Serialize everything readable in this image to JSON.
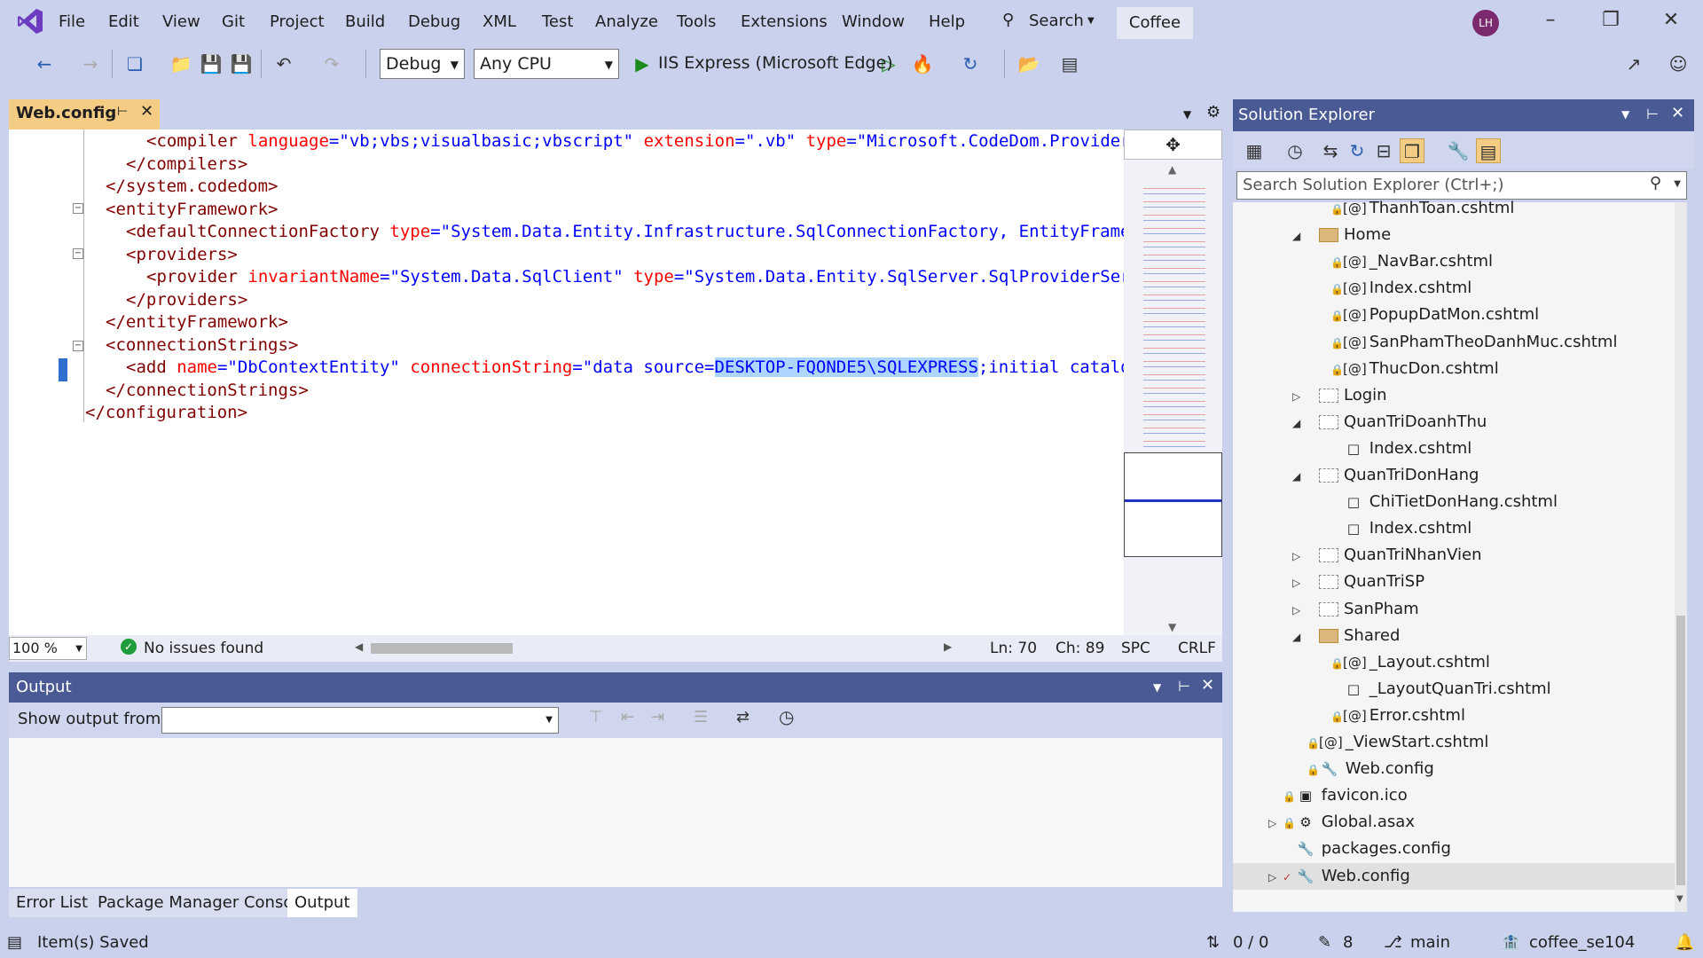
{
  "menubar": {
    "items": [
      "File",
      "Edit",
      "View",
      "Git",
      "Project",
      "Build",
      "Debug",
      "XML",
      "Test",
      "Analyze",
      "Tools",
      "Extensions",
      "Window",
      "Help"
    ],
    "search_label": "Search",
    "solution_name": "Coffee",
    "user_initials": "LH"
  },
  "toolbar": {
    "config": "Debug",
    "platform": "Any CPU",
    "run_target": "IIS Express (Microsoft Edge)"
  },
  "editor": {
    "tab_title": "Web.config",
    "zoom": "100 %",
    "issues": "No issues found",
    "line": "Ln: 70",
    "char": "Ch: 89",
    "whitespace": "SPC",
    "line_ending": "CRLF",
    "code": [
      {
        "indent": 3,
        "parts": [
          [
            "<",
            "tag"
          ],
          [
            "compiler ",
            "tag"
          ],
          [
            "language",
            "attr"
          ],
          [
            "=\"",
            "val"
          ],
          [
            "vb;vbs;visualbasic;vbscript",
            "val"
          ],
          [
            "\" ",
            "val"
          ],
          [
            "extension",
            "attr"
          ],
          [
            "=\".vb\" ",
            "val"
          ],
          [
            "type",
            "attr"
          ],
          [
            "=\"Microsoft.CodeDom.Provider",
            "val"
          ]
        ]
      },
      {
        "indent": 2,
        "parts": [
          [
            "</compilers>",
            "tag"
          ]
        ]
      },
      {
        "indent": 1,
        "parts": [
          [
            "</system.codedom>",
            "tag"
          ]
        ]
      },
      {
        "indent": 1,
        "parts": [
          [
            "<entityFramework>",
            "tag"
          ]
        ]
      },
      {
        "indent": 2,
        "parts": [
          [
            "<defaultConnectionFactory ",
            "tag"
          ],
          [
            "type",
            "attr"
          ],
          [
            "=\"System.Data.Entity.Infrastructure.SqlConnectionFactory, EntityFrame",
            "val"
          ]
        ]
      },
      {
        "indent": 2,
        "parts": [
          [
            "<providers>",
            "tag"
          ]
        ]
      },
      {
        "indent": 3,
        "parts": [
          [
            "<provider ",
            "tag"
          ],
          [
            "invariantName",
            "attr"
          ],
          [
            "=\"System.Data.SqlClient\" ",
            "val"
          ],
          [
            "type",
            "attr"
          ],
          [
            "=\"System.Data.Entity.SqlServer.SqlProviderSer",
            "val"
          ]
        ]
      },
      {
        "indent": 2,
        "parts": [
          [
            "</providers>",
            "tag"
          ]
        ]
      },
      {
        "indent": 1,
        "parts": [
          [
            "</entityFramework>",
            "tag"
          ]
        ]
      },
      {
        "indent": 1,
        "parts": [
          [
            "<connectionStrings>",
            "tag"
          ]
        ]
      },
      {
        "indent": 2,
        "parts": [
          [
            "<add ",
            "tag"
          ],
          [
            "name",
            "attr"
          ],
          [
            "=\"DbContextEntity\" ",
            "val"
          ],
          [
            "connectionString",
            "attr"
          ],
          [
            "=\"data source=",
            "val"
          ],
          [
            "DESKTOP-FQONDE5\\SQLEXPRESS",
            "sel"
          ],
          [
            ";initial catalo",
            "val"
          ]
        ]
      },
      {
        "indent": 1,
        "parts": [
          [
            "</connectionStrings>",
            "tag"
          ]
        ]
      },
      {
        "indent": 0,
        "parts": [
          [
            "</configuration>",
            "tag"
          ]
        ]
      }
    ]
  },
  "solution_explorer": {
    "title": "Solution Explorer",
    "search_placeholder": "Search Solution Explorer (Ctrl+;)",
    "items": [
      {
        "label": "ThanhToan.cshtml",
        "indent": 3,
        "type": "razor",
        "lock": true,
        "expander": ""
      },
      {
        "label": "Home",
        "indent": 2,
        "type": "folder",
        "lock": false,
        "expander": "open"
      },
      {
        "label": "_NavBar.cshtml",
        "indent": 3,
        "type": "razor",
        "lock": true,
        "expander": ""
      },
      {
        "label": "Index.cshtml",
        "indent": 3,
        "type": "razor",
        "lock": true,
        "expander": ""
      },
      {
        "label": "PopupDatMon.cshtml",
        "indent": 3,
        "type": "razor",
        "lock": true,
        "expander": ""
      },
      {
        "label": "SanPhamTheoDanhMuc.cshtml",
        "indent": 3,
        "type": "razor",
        "lock": true,
        "expander": ""
      },
      {
        "label": "ThucDon.cshtml",
        "indent": 3,
        "type": "razor",
        "lock": true,
        "expander": ""
      },
      {
        "label": "Login",
        "indent": 2,
        "type": "folder-empty",
        "lock": false,
        "expander": "closed"
      },
      {
        "label": "QuanTriDoanhThu",
        "indent": 2,
        "type": "folder-empty",
        "lock": false,
        "expander": "open"
      },
      {
        "label": "Index.cshtml",
        "indent": 3,
        "type": "page",
        "lock": false,
        "expander": ""
      },
      {
        "label": "QuanTriDonHang",
        "indent": 2,
        "type": "folder-empty",
        "lock": false,
        "expander": "open"
      },
      {
        "label": "ChiTietDonHang.cshtml",
        "indent": 3,
        "type": "page",
        "lock": false,
        "expander": ""
      },
      {
        "label": "Index.cshtml",
        "indent": 3,
        "type": "page",
        "lock": false,
        "expander": ""
      },
      {
        "label": "QuanTriNhanVien",
        "indent": 2,
        "type": "folder-empty",
        "lock": false,
        "expander": "closed"
      },
      {
        "label": "QuanTriSP",
        "indent": 2,
        "type": "folder-empty",
        "lock": false,
        "expander": "closed"
      },
      {
        "label": "SanPham",
        "indent": 2,
        "type": "folder-empty",
        "lock": false,
        "expander": "closed"
      },
      {
        "label": "Shared",
        "indent": 2,
        "type": "folder",
        "lock": false,
        "expander": "open"
      },
      {
        "label": "_Layout.cshtml",
        "indent": 3,
        "type": "razor",
        "lock": true,
        "expander": ""
      },
      {
        "label": "_LayoutQuanTri.cshtml",
        "indent": 3,
        "type": "page",
        "lock": false,
        "expander": ""
      },
      {
        "label": "Error.cshtml",
        "indent": 3,
        "type": "razor",
        "lock": true,
        "expander": ""
      },
      {
        "label": "_ViewStart.cshtml",
        "indent": 2,
        "type": "razor",
        "lock": true,
        "expander": ""
      },
      {
        "label": "Web.config",
        "indent": 2,
        "type": "config",
        "lock": true,
        "expander": ""
      },
      {
        "label": "favicon.ico",
        "indent": 1,
        "type": "image",
        "lock": true,
        "expander": ""
      },
      {
        "label": "Global.asax",
        "indent": 1,
        "type": "asax",
        "lock": true,
        "expander": "closed"
      },
      {
        "label": "packages.config",
        "indent": 1,
        "type": "config",
        "lock": false,
        "expander": ""
      },
      {
        "label": "Web.config",
        "indent": 1,
        "type": "config",
        "lock": false,
        "expander": "closed",
        "check": true
      }
    ]
  },
  "output": {
    "title": "Output",
    "show_from_label": "Show output from:",
    "show_from_value": ""
  },
  "bottom_tabs": [
    "Error List",
    "Package Manager Console",
    "Output"
  ],
  "status": {
    "message": "Item(s) Saved",
    "sync": "0 / 0",
    "pending": "8",
    "branch": "main",
    "repo": "coffee_se104"
  },
  "colors": {
    "accent": "#4a5a95",
    "chrome": "#c9d1ec",
    "active_tab": "#f5cc84"
  }
}
